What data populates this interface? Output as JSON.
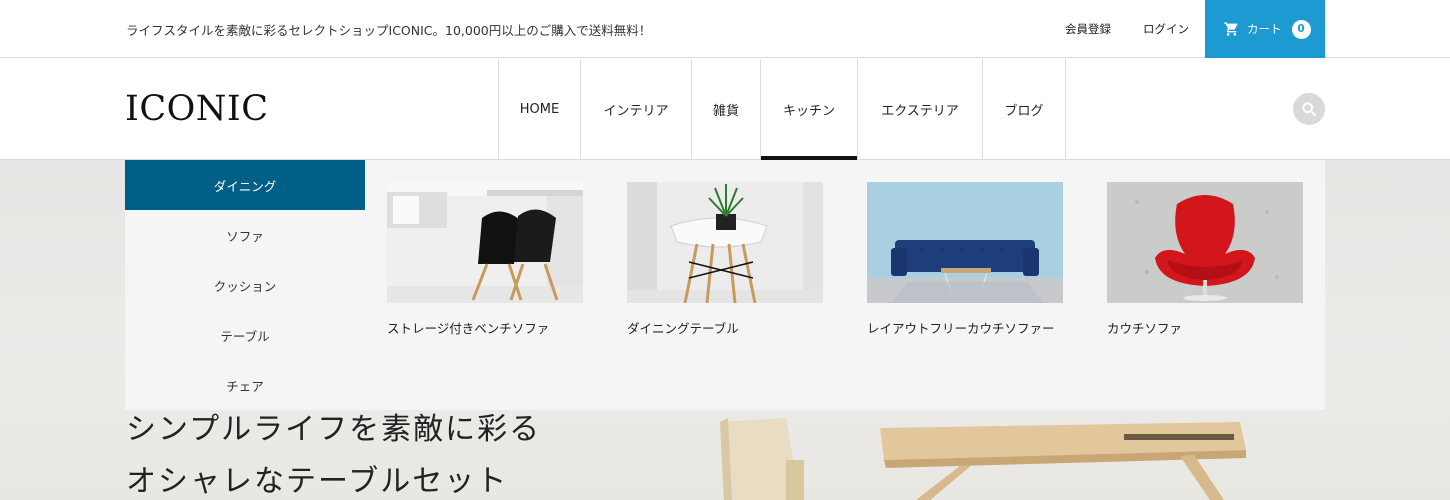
{
  "topbar": {
    "announcement": "ライフスタイルを素敵に彩るセレクトショップICONIC。10,000円以上のご購入で送料無料！",
    "register": "会員登録",
    "login": "ログイン",
    "cart_label": "カート",
    "cart_count": "0"
  },
  "header": {
    "logo": "ICONIC",
    "nav": [
      "HOME",
      "インテリア",
      "雑貨",
      "キッチン",
      "エクステリア",
      "ブログ"
    ],
    "active_nav": "キッチン"
  },
  "megamenu": {
    "subnav": [
      "ダイニング",
      "ソファ",
      "クッション",
      "テーブル",
      "チェア"
    ],
    "active_subnav": "ダイニング",
    "products": [
      {
        "title": "ストレージ付きベンチソファ",
        "image": "black-chairs-photo"
      },
      {
        "title": "ダイニングテーブル",
        "image": "white-chair-plant-photo"
      },
      {
        "title": "レイアウトフリーカウチソファー",
        "image": "blue-sofa-photo"
      },
      {
        "title": "カウチソファ",
        "image": "red-swan-chair-photo"
      }
    ]
  },
  "hero": {
    "title_line1": "シンプルライフを素敵に彩る",
    "title_line2": "オシャレなテーブルセット"
  },
  "colors": {
    "accent": "#1d9ad1",
    "submenu_active": "#005f86"
  }
}
